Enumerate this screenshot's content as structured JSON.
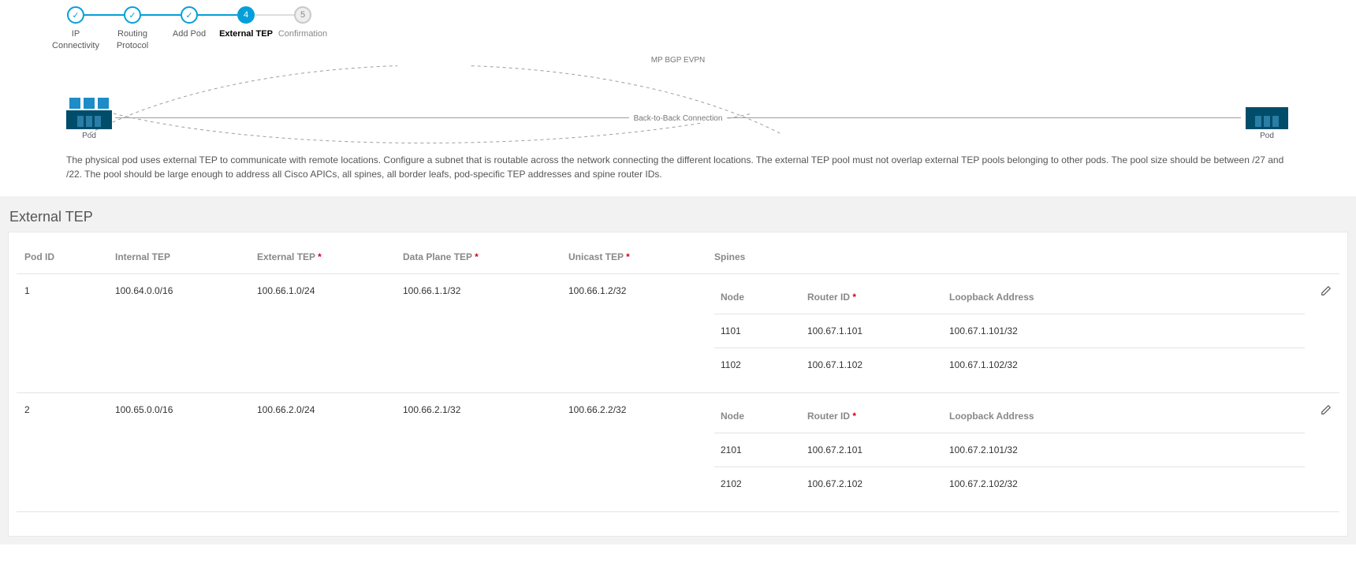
{
  "stepper": {
    "steps": [
      {
        "label": "IP Connectivity",
        "icon": "check"
      },
      {
        "label": "Routing Protocol",
        "icon": "check"
      },
      {
        "label": "Add Pod",
        "icon": "check"
      },
      {
        "label": "External TEP",
        "num": "4"
      },
      {
        "label": "Confirmation",
        "num": "5"
      }
    ]
  },
  "diagram": {
    "top_label": "MP BGP EVPN",
    "mid_label": "Back-to-Back Connection",
    "left_label": "Pod",
    "right_label": "Pod"
  },
  "description": "The physical pod uses external TEP to communicate with remote locations. Configure a subnet that is routable across the network connecting the different locations. The external TEP pool must not overlap external TEP pools belonging to other pods. The pool size should be between /27 and /22. The pool should be large enough to address all Cisco APICs, all spines, all border leafs, pod-specific TEP addresses and spine router IDs.",
  "section": {
    "title": "External TEP"
  },
  "headers": {
    "pod_id": "Pod ID",
    "internal_tep": "Internal TEP",
    "external_tep": "External TEP",
    "data_plane_tep": "Data Plane TEP",
    "unicast_tep": "Unicast TEP",
    "spines": "Spines",
    "node": "Node",
    "router_id": "Router ID",
    "loopback": "Loopback Address"
  },
  "rows": [
    {
      "pod_id": "1",
      "internal_tep": "100.64.0.0/16",
      "external_tep": "100.66.1.0/24",
      "data_plane_tep": "100.66.1.1/32",
      "unicast_tep": "100.66.1.2/32",
      "spines": [
        {
          "node": "1101",
          "router_id": "100.67.1.101",
          "loopback": "100.67.1.101/32"
        },
        {
          "node": "1102",
          "router_id": "100.67.1.102",
          "loopback": "100.67.1.102/32"
        }
      ]
    },
    {
      "pod_id": "2",
      "internal_tep": "100.65.0.0/16",
      "external_tep": "100.66.2.0/24",
      "data_plane_tep": "100.66.2.1/32",
      "unicast_tep": "100.66.2.2/32",
      "spines": [
        {
          "node": "2101",
          "router_id": "100.67.2.101",
          "loopback": "100.67.2.101/32"
        },
        {
          "node": "2102",
          "router_id": "100.67.2.102",
          "loopback": "100.67.2.102/32"
        }
      ]
    }
  ]
}
